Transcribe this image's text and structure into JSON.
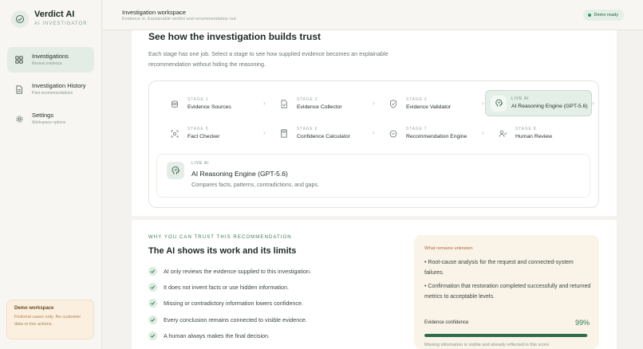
{
  "brand": {
    "name": "Verdict AI",
    "subtitle": "AI INVESTIGATOR"
  },
  "sidebar": {
    "items": [
      {
        "label": "Investigations",
        "sub": "Review evidence",
        "icon": "grid-icon",
        "active": true
      },
      {
        "label": "Investigation History",
        "sub": "Past recommendations",
        "icon": "document-icon",
        "active": false
      },
      {
        "label": "Settings",
        "sub": "Workspace options",
        "icon": "gear-icon",
        "active": false
      }
    ],
    "demo": {
      "title": "Demo workspace",
      "text": "Fictional cases only. No customer data or live actions."
    }
  },
  "header": {
    "title": "Investigation workspace",
    "subtitle": "Evidence in. Explainable verdict and recommendation out.",
    "badge": "Demo ready"
  },
  "main": {
    "title": "See how the investigation builds trust",
    "description": "Each stage has one job. Select a stage to see how supplied evidence becomes an explainable recommendation without hiding the reasoning."
  },
  "stages": [
    {
      "kicker": "STAGE 1",
      "name": "Evidence Sources",
      "icon": "database-icon"
    },
    {
      "kicker": "STAGE 2",
      "name": "Evidence Collector",
      "icon": "file-collect-icon"
    },
    {
      "kicker": "STAGE 3",
      "name": "Evidence Validator",
      "icon": "shield-check-icon"
    },
    {
      "kicker": "LIVE AI",
      "name": "AI Reasoning Engine (GPT-5.6)",
      "icon": "brain-icon"
    },
    {
      "kicker": "STAGE 5",
      "name": "Fact Checker",
      "icon": "scan-icon"
    },
    {
      "kicker": "STAGE 6",
      "name": "Confidence Calculator",
      "icon": "calculator-icon"
    },
    {
      "kicker": "STAGE 7",
      "name": "Recommendation Engine",
      "icon": "target-icon"
    },
    {
      "kicker": "STAGE 8",
      "name": "Human Review",
      "icon": "user-check-icon"
    }
  ],
  "live": {
    "kicker": "LIVE AI",
    "name": "AI Reasoning Engine (GPT-5.6)",
    "description": "Compares facts, patterns, contradictions, and gaps."
  },
  "trust": {
    "kicker": "WHY YOU CAN TRUST THIS RECOMMENDATION",
    "title": "The AI shows its work and its limits",
    "items": [
      "AI only reviews the evidence supplied to this investigation.",
      "It does not invent facts or use hidden information.",
      "Missing or contradictory information lowers confidence.",
      "Every conclusion remains connected to visible evidence.",
      "A human always makes the final decision."
    ]
  },
  "unknown": {
    "title": "What remains unknown",
    "items": [
      "• Root-cause analysis for the request and connected-system failures.",
      "• Confirmation that restoration completed successfully and returned metrics to acceptable levels."
    ],
    "confidence_label": "Evidence confidence",
    "confidence_value": "99%",
    "confidence_fraction": 0.99,
    "note": "Missing information is visible and already reflected in this score."
  },
  "colors": {
    "accent": "#2e6d4c",
    "active_bg": "#e4efe7",
    "warning_bg": "#faf3e8"
  }
}
